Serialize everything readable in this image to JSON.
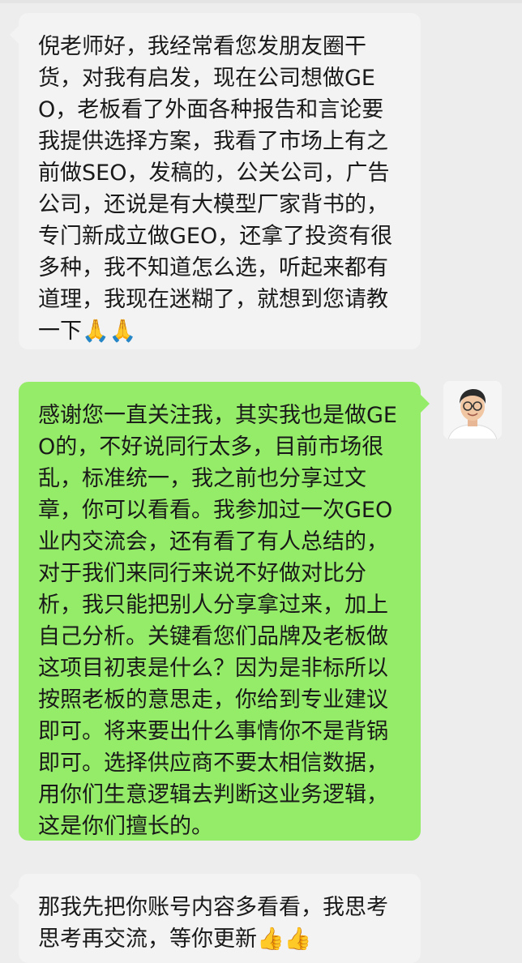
{
  "messages": [
    {
      "id": "msg1",
      "side": "received",
      "text": "倪老师好，我经常看您发朋友圈干货，对我有启发，现在公司想做GEO，老板看了外面各种报告和言论要我提供选择方案，我看了市场上有之前做SEO，发稿的，公关公司，广告公司，还说是有大模型厂家背书的，专门新成立做GEO，还拿了投资有很多种，我不知道怎么选，听起来都有道理，我现在迷糊了，就想到您请教一下",
      "emoji": "🙏🙏"
    },
    {
      "id": "msg2",
      "side": "sent",
      "text": "感谢您一直关注我，其实我也是做GEO的，不好说同行太多，目前市场很乱，标准统一，我之前也分享过文章，你可以看看。我参加过一次GEO业内交流会，还有看了有人总结的，对于我们来同行来说不好做对比分析，我只能把别人分享拿过来，加上自己分析。关键看您们品牌及老板做这项目初衷是什么？因为是非标所以按照老板的意思走，你给到专业建议即可。将来要出什么事情你不是背锅即可。选择供应商不要太相信数据，用你们生意逻辑去判断这业务逻辑，这是你们擅长的。",
      "emoji": ""
    },
    {
      "id": "msg3",
      "side": "received",
      "text": "那我先把你账号内容多看看，我思考思考再交流，等你更新",
      "emoji": "👍👍"
    }
  ],
  "sender_avatar": {
    "icon": "person-avatar-icon"
  },
  "colors": {
    "background": "#ededed",
    "received_bubble": "#f3f3f3",
    "sent_bubble": "#95ec69",
    "text": "#191919"
  }
}
